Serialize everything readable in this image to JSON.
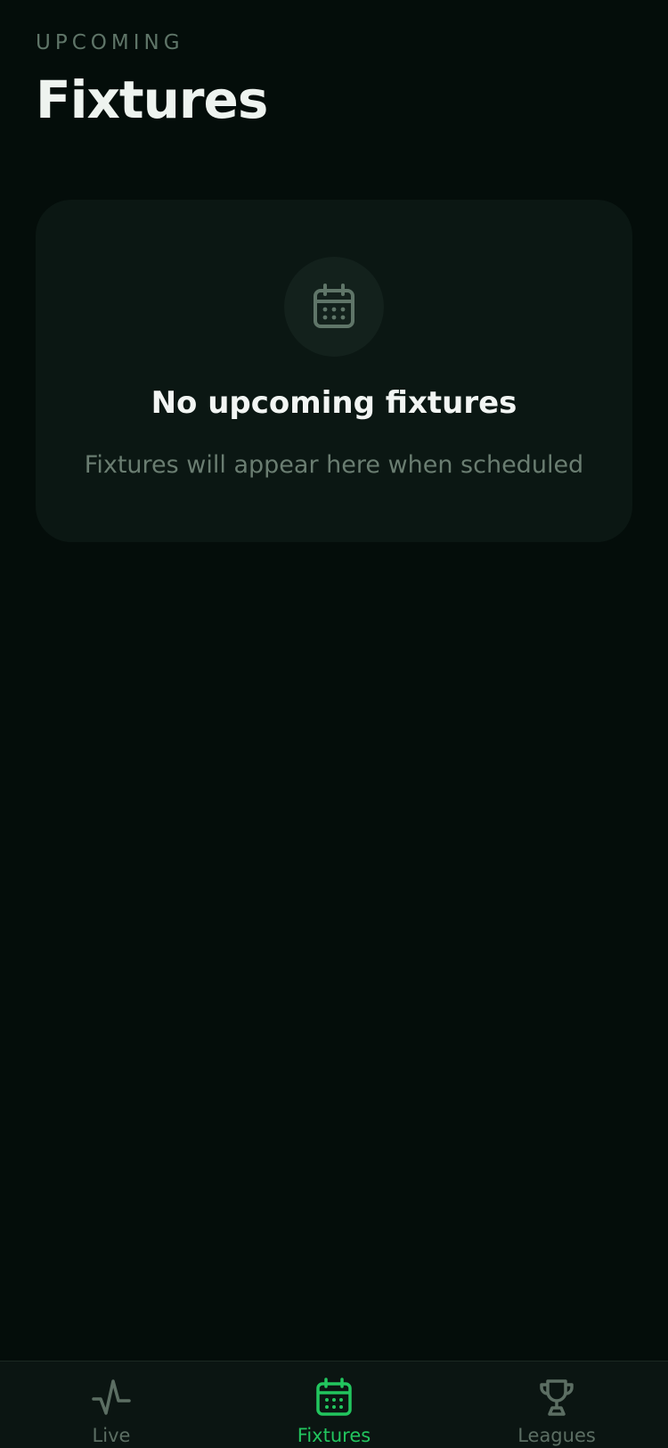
{
  "header": {
    "eyebrow": "UPCOMING",
    "title": "Fixtures"
  },
  "empty_state": {
    "icon": "calendar-icon",
    "title": "No upcoming fixtures",
    "subtitle": "Fixtures will appear here when scheduled"
  },
  "tabbar": {
    "tabs": [
      {
        "label": "Live",
        "icon": "pulse-icon",
        "active": false
      },
      {
        "label": "Fixtures",
        "icon": "calendar-icon",
        "active": true
      },
      {
        "label": "Leagues",
        "icon": "trophy-icon",
        "active": false
      }
    ]
  },
  "colors": {
    "background": "#040d0a",
    "card": "#0b1713",
    "accent": "#22c55e",
    "muted": "#5c6e63",
    "text": "#eef3ef"
  }
}
